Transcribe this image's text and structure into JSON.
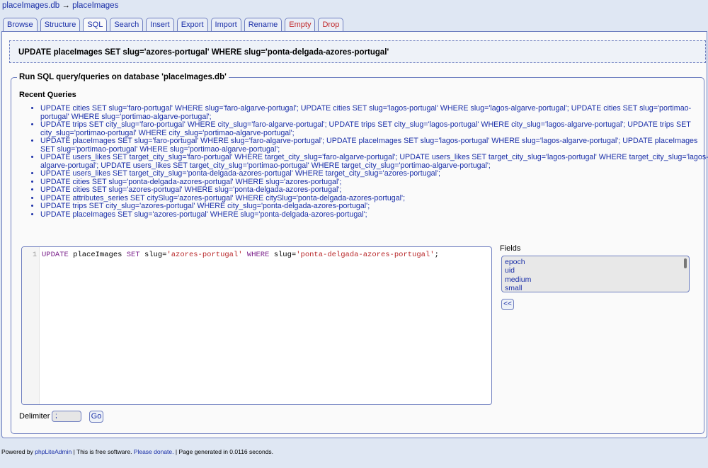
{
  "breadcrumb": {
    "db": "placeImages.db",
    "arrow": "→",
    "table": "placeImages"
  },
  "tabs": [
    {
      "label": "Browse"
    },
    {
      "label": "Structure"
    },
    {
      "label": "SQL"
    },
    {
      "label": "Search"
    },
    {
      "label": "Insert"
    },
    {
      "label": "Export"
    },
    {
      "label": "Import"
    },
    {
      "label": "Rename"
    },
    {
      "label": "Empty"
    },
    {
      "label": "Drop"
    }
  ],
  "message": "UPDATE placeImages SET slug='azores-portugal' WHERE slug='ponta-delgada-azores-portugal'",
  "fieldset_legend": "Run SQL query/queries on database 'placeImages.db'",
  "recent_title": "Recent Queries",
  "recent": [
    "UPDATE cities SET slug='faro-portugal' WHERE slug='faro-algarve-portugal'; UPDATE cities SET slug='lagos-portugal' WHERE slug='lagos-algarve-portugal'; UPDATE cities SET slug='portimao-portugal' WHERE slug='portimao-algarve-portugal';",
    "UPDATE trips SET city_slug='faro-portugal' WHERE city_slug='faro-algarve-portugal'; UPDATE trips SET city_slug='lagos-portugal' WHERE city_slug='lagos-algarve-portugal'; UPDATE trips SET city_slug='portimao-portugal' WHERE city_slug='portimao-algarve-portugal';",
    "UPDATE placeImages SET slug='faro-portugal' WHERE slug='faro-algarve-portugal'; UPDATE placeImages SET slug='lagos-portugal' WHERE slug='lagos-algarve-portugal'; UPDATE placeImages SET slug='portimao-portugal' WHERE slug='portimao-algarve-portugal';",
    "UPDATE users_likes SET target_city_slug='faro-portugal' WHERE target_city_slug='faro-algarve-portugal'; UPDATE users_likes SET target_city_slug='lagos-portugal' WHERE target_city_slug='lagos-algarve-portugal'; UPDATE users_likes SET target_city_slug='portimao-portugal' WHERE target_city_slug='portimao-algarve-portugal';",
    "UPDATE users_likes SET target_city_slug='ponta-delgada-azores-portugal' WHERE target_city_slug='azores-portugal';",
    "UPDATE cities SET slug='ponta-delgada-azores-portugal' WHERE slug='azores-portugal';",
    "UPDATE cities SET slug='azores-portugal' WHERE slug='ponta-delgada-azores-portugal';",
    "UPDATE attributes_series SET citySlug='azores-portugal' WHERE citySlug='ponta-delgada-azores-portugal';",
    "UPDATE trips SET city_slug='azores-portugal' WHERE city_slug='ponta-delgada-azores-portugal';",
    "UPDATE placeImages SET slug='azores-portugal' WHERE slug='ponta-delgada-azores-portugal';"
  ],
  "editor": {
    "line_number": "1",
    "tokens": {
      "t1": "UPDATE",
      "t2": " placeImages ",
      "t3": "SET",
      "t4": " slug=",
      "t5": "'azores-portugal'",
      "t6": " ",
      "t7": "WHERE",
      "t8": " slug=",
      "t9": "'ponta-delgada-azores-portugal'",
      "t10": ";"
    }
  },
  "fields": {
    "label": "Fields",
    "items": [
      "epoch",
      "uid",
      "medium",
      "small"
    ],
    "insert_button": "<<"
  },
  "delimiter": {
    "label": "Delimiter",
    "value": ";",
    "go": "Go"
  },
  "footer": {
    "powered": "Powered by ",
    "link": "phpLiteAdmin",
    "free": " | This is free software. ",
    "donate": "Please donate.",
    "generated": " | Page generated in 0.0116 seconds."
  }
}
